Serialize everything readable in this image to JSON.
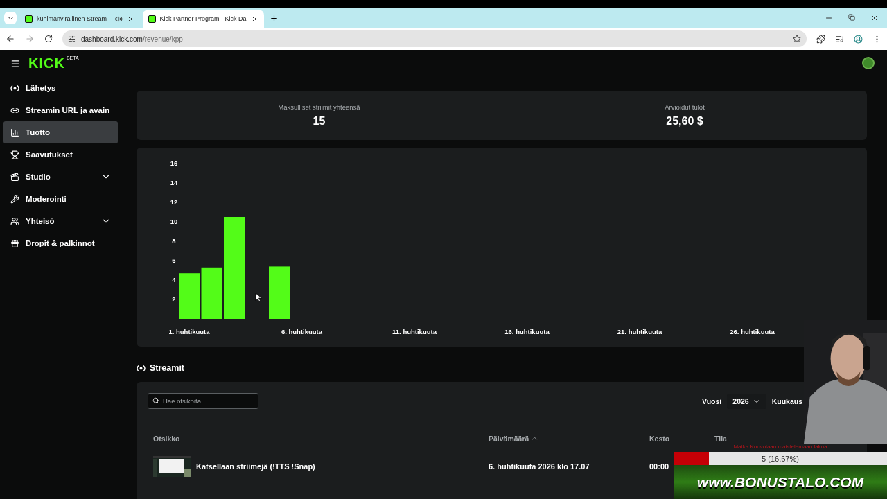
{
  "browser": {
    "tabs": [
      {
        "title": "kuhlmanvirallinen Stream -",
        "selected": false,
        "audio": true
      },
      {
        "title": "Kick Partner Program - Kick Da",
        "selected": true,
        "audio": false
      }
    ],
    "url": {
      "host": "dashboard.kick.com",
      "path": "/revenue/kpp"
    }
  },
  "logo": {
    "text": "KICK",
    "badge": "BETA"
  },
  "sidebar": {
    "items": [
      {
        "label": "Lähetys",
        "selected": false,
        "expandable": false
      },
      {
        "label": "Streamin URL ja avain",
        "selected": false,
        "expandable": false
      },
      {
        "label": "Tuotto",
        "selected": true,
        "expandable": false
      },
      {
        "label": "Saavutukset",
        "selected": false,
        "expandable": false
      },
      {
        "label": "Studio",
        "selected": false,
        "expandable": true
      },
      {
        "label": "Moderointi",
        "selected": false,
        "expandable": false
      },
      {
        "label": "Yhteisö",
        "selected": false,
        "expandable": true
      },
      {
        "label": "Dropit & palkinnot",
        "selected": false,
        "expandable": false
      }
    ]
  },
  "stats": [
    {
      "label": "Maksulliset striimit yhteensä",
      "value": "15"
    },
    {
      "label": "Arvioidut tulot",
      "value": "25,60 $"
    }
  ],
  "chart": {
    "chart_data": {
      "type": "bar",
      "categories": [
        "1. huhtikuuta",
        null,
        null,
        null,
        null,
        "6. huhtikuuta",
        null,
        null,
        null,
        null,
        "11. huhtikuuta",
        null,
        null,
        null,
        null,
        "16. huhtikuuta",
        null,
        null,
        null,
        null,
        "21. huhtikuuta",
        null,
        null,
        null,
        null,
        "26. huhtikuuta",
        null,
        null,
        null,
        null
      ],
      "series": [
        {
          "color": "#53fc18",
          "values": [
            4.7,
            5.3,
            10.5,
            null,
            5.4,
            null,
            null,
            null,
            null,
            null,
            null,
            null,
            null,
            null,
            null,
            null,
            null,
            null,
            null,
            null,
            null,
            null,
            null,
            null,
            null,
            null,
            null,
            null,
            null,
            null
          ]
        }
      ],
      "ylim": [
        0,
        16
      ],
      "yticks": [
        2,
        4,
        6,
        8,
        10,
        12,
        14,
        16
      ]
    }
  },
  "streams": {
    "title": "Streamit",
    "search": {
      "placeholder": "Hae otsikoita"
    },
    "filters": [
      {
        "label": "Vuosi",
        "value": "2026"
      },
      {
        "label": "Kuukaus"
      }
    ],
    "columns": [
      {
        "label": "Otsikko",
        "sorted": false
      },
      {
        "label": "Päivämäärä",
        "sorted": true
      },
      {
        "label": "Kesto",
        "sorted": false
      },
      {
        "label": "Tila",
        "sorted": false
      }
    ],
    "rows": [
      {
        "title": "Katsellaan striimejä (!TTS !Snap)",
        "date": "6. huhtikuuta 2026 klo 17.07",
        "duration": "00:00"
      }
    ]
  },
  "overlay": {
    "goal": {
      "title": "Matka Kouvolaan maistelemaan lakua",
      "reading": "5 (16.67%)",
      "level": 0.1667
    },
    "banner": "www.BONUSTALO.COM"
  }
}
